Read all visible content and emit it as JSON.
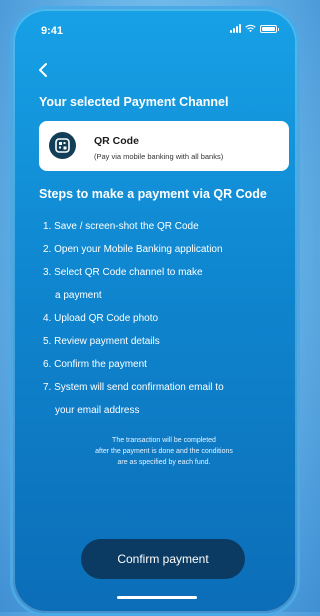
{
  "status_bar": {
    "time": "9:41"
  },
  "header": {
    "selected_title": "Your selected Payment Channel"
  },
  "channel_card": {
    "title": "QR Code",
    "subtitle": "(Pay via mobile banking with all banks)",
    "icon": "qr-code-icon"
  },
  "steps": {
    "title": "Steps to make a payment via QR Code",
    "items": [
      "1. Save / screen-shot the QR Code",
      "2. Open your Mobile Banking application",
      "3. Select QR Code channel to make",
      "a payment",
      "4. Upload QR Code photo",
      "5. Review payment details",
      "6. Confirm the payment",
      "7. System will send confirmation email to",
      "your email address"
    ]
  },
  "note": {
    "line1": "The transaction will be completed",
    "line2": "after the payment is done and the conditions",
    "line3": "are as specified by each fund."
  },
  "actions": {
    "confirm_label": "Confirm payment"
  },
  "colors": {
    "primary": "#0f86cf",
    "button": "#0b3b63",
    "card": "#ffffff"
  }
}
